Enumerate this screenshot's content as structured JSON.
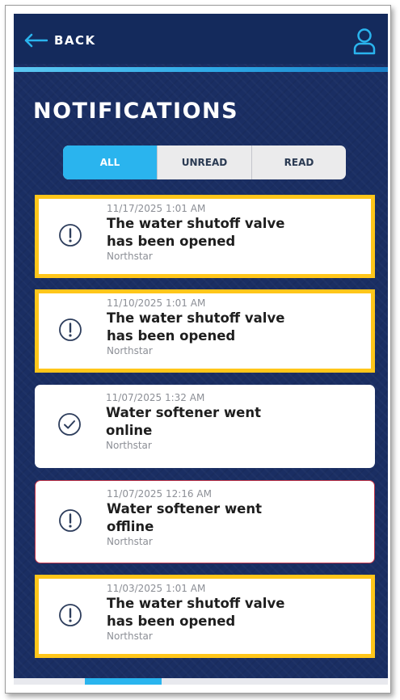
{
  "header": {
    "back_label": "BACK"
  },
  "page": {
    "title": "NOTIFICATIONS"
  },
  "tabs": [
    {
      "label": "ALL",
      "active": true
    },
    {
      "label": "UNREAD",
      "active": false
    },
    {
      "label": "READ",
      "active": false
    }
  ],
  "notifications": [
    {
      "time": "11/17/2025 1:01 AM",
      "title": "The water shutoff valve has been opened",
      "source": "Northstar",
      "icon": "exclamation-circle-icon",
      "style": "highlight"
    },
    {
      "time": "11/10/2025 1:01 AM",
      "title": "The water shutoff valve has been opened",
      "source": "Northstar",
      "icon": "exclamation-circle-icon",
      "style": "highlight"
    },
    {
      "time": "11/07/2025 1:32 AM",
      "title": "Water softener went online",
      "source": "Northstar",
      "icon": "check-circle-icon",
      "style": "normal"
    },
    {
      "time": "11/07/2025 12:16 AM",
      "title": "Water softener went offline",
      "source": "Northstar",
      "icon": "exclamation-circle-icon",
      "style": "alert"
    },
    {
      "time": "11/03/2025 1:01 AM",
      "title": "The water shutoff valve has been opened",
      "source": "Northstar",
      "icon": "exclamation-circle-icon",
      "style": "highlight"
    }
  ],
  "colors": {
    "background": "#1a2e63",
    "accent": "#2ab4ee",
    "highlight_border": "#ffc61a",
    "alert_border": "#c2364a",
    "icon": "#2d3d5c"
  }
}
